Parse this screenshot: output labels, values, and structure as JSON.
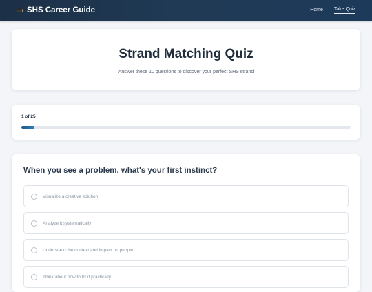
{
  "navbar": {
    "brand_icon": "graduation-cap-icon",
    "brand": "SHS Career Guide",
    "links": [
      {
        "label": "Home",
        "active": false
      },
      {
        "label": "Take Quiz",
        "active": true
      }
    ]
  },
  "hero": {
    "title": "Strand Matching Quiz",
    "subtitle": "Answer these 10 questions to discover your perfect SHS strand"
  },
  "progress": {
    "label": "1 of 25",
    "fraction": 0.04
  },
  "question": {
    "text": "When you see a problem, what's your first instinct?",
    "options": [
      {
        "label": "Visualize a creative solution"
      },
      {
        "label": "Analyze it systematically"
      },
      {
        "label": "Understand the context and impact on people"
      },
      {
        "label": "Think about how to fix it practically"
      }
    ]
  },
  "colors": {
    "navbar": "#1c3047",
    "accent": "#1d5a8a",
    "background": "#f3f5f8"
  }
}
